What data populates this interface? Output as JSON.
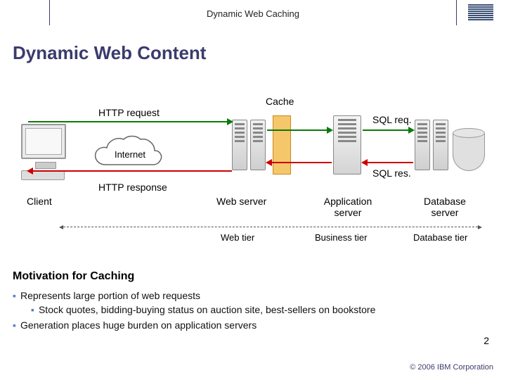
{
  "header": {
    "title": "Dynamic Web Caching",
    "logo": "IBM"
  },
  "slide": {
    "title": "Dynamic Web  Content",
    "diagram": {
      "cache": "Cache",
      "http_request": "HTTP request",
      "http_response": "HTTP response",
      "internet": "Internet",
      "sql_req": "SQL req.",
      "sql_res": "SQL res.",
      "client": "Client",
      "web_server": "Web server",
      "app_server": "Application server",
      "db_server": "Database server",
      "web_tier": "Web tier",
      "business_tier": "Business tier",
      "db_tier": "Database tier"
    },
    "section_heading": "Motivation for Caching",
    "bullets": {
      "b1": "Represents large portion of web requests",
      "b2": "Stock quotes, bidding-buying status on auction site, best-sellers on bookstore",
      "b3": "Generation places huge burden on application servers"
    },
    "page_number": "2",
    "copyright": "© 2006 IBM Corporation"
  }
}
